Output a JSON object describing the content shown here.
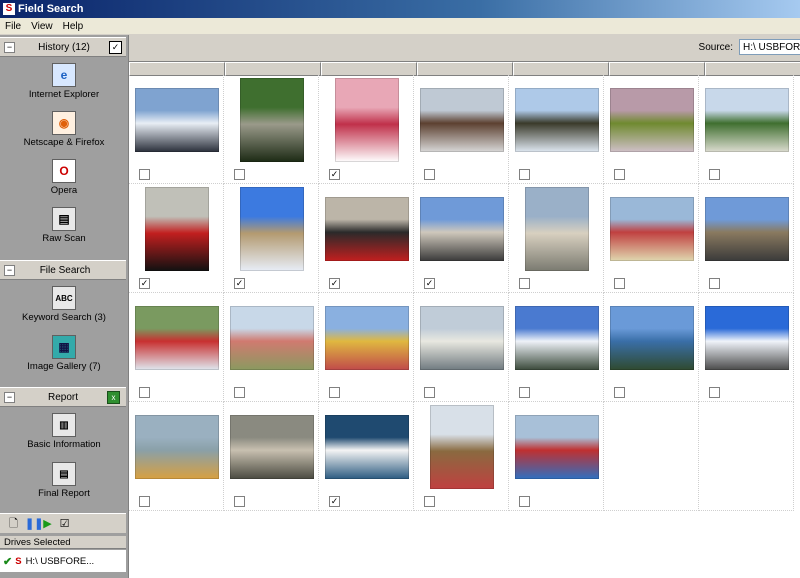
{
  "window": {
    "title": "Field Search"
  },
  "menu": [
    "File",
    "View",
    "Help"
  ],
  "sidebar": {
    "history": {
      "label": "History (12)",
      "items": [
        {
          "label": "Internet Explorer",
          "icon": "internet-explorer-icon"
        },
        {
          "label": "Netscape & Firefox",
          "icon": "firefox-icon"
        },
        {
          "label": "Opera",
          "icon": "opera-icon"
        },
        {
          "label": "Raw Scan",
          "icon": "raw-scan-icon"
        }
      ]
    },
    "file_search": {
      "label": "File Search",
      "items": [
        {
          "label": "Keyword Search (3)",
          "icon": "keyword-search-icon"
        },
        {
          "label": "Image Gallery (7)",
          "icon": "image-gallery-icon"
        }
      ]
    },
    "report": {
      "label": "Report",
      "items": [
        {
          "label": "Basic Information",
          "icon": "basic-information-icon"
        },
        {
          "label": "Final Report",
          "icon": "final-report-icon"
        }
      ]
    },
    "drives": {
      "header": "Drives Selected",
      "drive": "H:\\ USBFORE..."
    }
  },
  "source": {
    "label": "Source:",
    "value": "H:\\ USBFORE"
  },
  "gallery": {
    "rows": [
      [
        {
          "subject": "snowy mountain peaks",
          "colors": [
            "#7fa3d0",
            "#e8eef5",
            "#2a2f3a"
          ],
          "shape": "landscape",
          "checked": false
        },
        {
          "subject": "stone statue with trees",
          "colors": [
            "#3f6f2f",
            "#9a9a8a",
            "#1c2a14"
          ],
          "shape": "portrait",
          "checked": false
        },
        {
          "subject": "red painted building",
          "colors": [
            "#e8a7b6",
            "#c0304a",
            "#fff"
          ],
          "shape": "portrait",
          "checked": true
        },
        {
          "subject": "horse carriage on street",
          "colors": [
            "#bfc9d4",
            "#5c4030",
            "#d8d8d8"
          ],
          "shape": "landscape",
          "checked": false
        },
        {
          "subject": "gargoyle against sky",
          "colors": [
            "#aec9e8",
            "#3a3a2a",
            "#dfe8f2"
          ],
          "shape": "landscape",
          "checked": false
        },
        {
          "subject": "green gargoyle",
          "colors": [
            "#b89aa8",
            "#6f8a2f",
            "#d0c0c8"
          ],
          "shape": "landscape",
          "checked": false
        },
        {
          "subject": "hilltop fortress",
          "colors": [
            "#c8d8ea",
            "#3f6f2f",
            "#dcdcd0"
          ],
          "shape": "landscape",
          "checked": false
        }
      ],
      [
        {
          "subject": "royal guards marching",
          "colors": [
            "#c0c0b8",
            "#c21f1f",
            "#111"
          ],
          "shape": "portrait",
          "checked": true
        },
        {
          "subject": "Big Ben clock tower",
          "colors": [
            "#3c7ae0",
            "#b39a70",
            "#e8eef8"
          ],
          "shape": "portrait",
          "checked": true
        },
        {
          "subject": "guard at palace gate",
          "colors": [
            "#bcb5a8",
            "#2a2a2a",
            "#c21f1f"
          ],
          "shape": "landscape",
          "checked": true
        },
        {
          "subject": "triumphal arch",
          "colors": [
            "#6f9ad8",
            "#cfc8bc",
            "#3a3a3a"
          ],
          "shape": "landscape",
          "checked": true
        },
        {
          "subject": "castle among cliffs",
          "colors": [
            "#9ab0c8",
            "#d8d0c0",
            "#7a7a70"
          ],
          "shape": "portrait",
          "checked": false
        },
        {
          "subject": "painted mural figures",
          "colors": [
            "#9ab8d8",
            "#c04040",
            "#e0d8b0"
          ],
          "shape": "landscape",
          "checked": false
        },
        {
          "subject": "gothic town hall",
          "colors": [
            "#6f9ad8",
            "#8a7a60",
            "#3a3a3a"
          ],
          "shape": "landscape",
          "checked": false
        }
      ],
      [
        {
          "subject": "cable car over valley",
          "colors": [
            "#7a9a60",
            "#c83030",
            "#dfe8f0"
          ],
          "shape": "landscape",
          "checked": false
        },
        {
          "subject": "painted townhouses",
          "colors": [
            "#c8d8e8",
            "#d07a70",
            "#8a9a60"
          ],
          "shape": "landscape",
          "checked": false
        },
        {
          "subject": "colorful row houses",
          "colors": [
            "#8ab0e0",
            "#e0b840",
            "#c04a4a"
          ],
          "shape": "landscape",
          "checked": false
        },
        {
          "subject": "hill basilica city view",
          "colors": [
            "#c0ccd8",
            "#e8e8e0",
            "#707a80"
          ],
          "shape": "landscape",
          "checked": false
        },
        {
          "subject": "alpine mountains",
          "colors": [
            "#4a7ad0",
            "#eef2f8",
            "#3a4a3a"
          ],
          "shape": "landscape",
          "checked": false
        },
        {
          "subject": "lake with mountains",
          "colors": [
            "#6a9ad8",
            "#3a6fa8",
            "#2f4a2f"
          ],
          "shape": "landscape",
          "checked": false
        },
        {
          "subject": "snow capped peak",
          "colors": [
            "#2a6ad8",
            "#f0f4fa",
            "#4a4a4a"
          ],
          "shape": "landscape",
          "checked": false
        }
      ],
      [
        {
          "subject": "boat on lake",
          "colors": [
            "#9ab0c0",
            "#8aa0a8",
            "#d8a040"
          ],
          "shape": "landscape",
          "checked": false
        },
        {
          "subject": "aerial city view",
          "colors": [
            "#8a8a80",
            "#c8c0b0",
            "#4a4a40"
          ],
          "shape": "landscape",
          "checked": false
        },
        {
          "subject": "white swan",
          "colors": [
            "#1f4a70",
            "#f4f4f4",
            "#2a5a80"
          ],
          "shape": "landscape",
          "checked": true
        },
        {
          "subject": "ornate shop sign",
          "colors": [
            "#d8e0e8",
            "#8a6a40",
            "#c04040"
          ],
          "shape": "portrait",
          "checked": false
        },
        {
          "subject": "colorful sculpture",
          "colors": [
            "#a8c0d8",
            "#c03030",
            "#3070c0"
          ],
          "shape": "landscape",
          "checked": false
        }
      ]
    ]
  }
}
